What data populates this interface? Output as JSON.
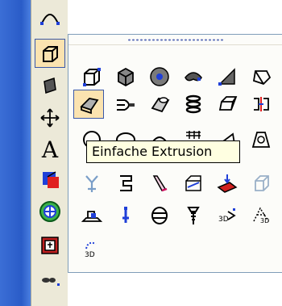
{
  "tooltip": {
    "text": "Einfache Extrusion"
  },
  "colors": {
    "icon_stroke": "#000000",
    "handle_blue": "#1f3fd8",
    "highlight": "#fbe3b0",
    "selection_border": "#3a58a8"
  },
  "toolbar": {
    "items": [
      {
        "icon": "arc-icon"
      },
      {
        "icon": "solid-box-icon"
      },
      {
        "icon": "surface-icon"
      },
      {
        "icon": "move-icon"
      },
      {
        "icon": "text-icon",
        "label": "A"
      },
      {
        "icon": "color-cube-icon"
      },
      {
        "icon": "target-icon"
      },
      {
        "icon": "group-icon"
      },
      {
        "icon": "more-icon"
      }
    ]
  },
  "flyout": {
    "rows": [
      [
        "box-icon",
        "cube-solid-icon",
        "cylinder-icon",
        "torus-icon",
        "wedge-icon",
        "pyramid-icon"
      ],
      [
        "simple-extrusion-icon",
        "sweep-icon",
        "tube-icon",
        "coil-icon",
        "skewed-box-icon",
        "split-icon"
      ],
      [
        "sphere-icon",
        "ellipsoid-icon",
        "dome-icon",
        "grid-icon",
        "wedge2-icon",
        "frustum-icon"
      ],
      [
        "fork-icon",
        "twisted-icon",
        "lofted-icon",
        "cut-box-icon",
        "red-plate-icon",
        "ghost-cube-icon"
      ],
      [
        "hull-icon",
        "pin-icon",
        "barrel-icon",
        "screw-icon",
        "arrow3d-icon",
        "network3d-icon"
      ],
      [
        "spiral3d-icon"
      ]
    ]
  }
}
